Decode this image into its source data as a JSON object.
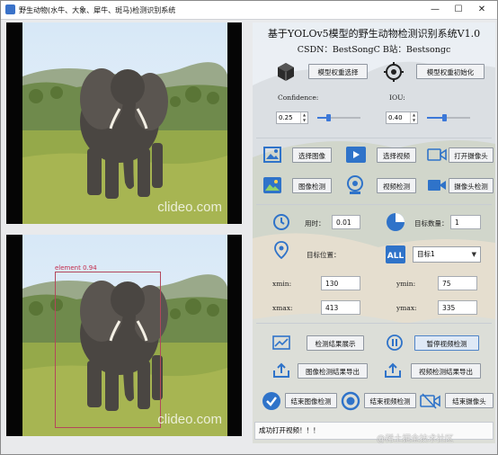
{
  "window": {
    "title": "野生动物(水牛、大象、犀牛、斑马)检测识别系统",
    "minimize_glyph": "—",
    "maximize_glyph": "☐",
    "close_glyph": "✕"
  },
  "header": {
    "title": "基于YOLOv5模型的野生动物检测识别系统V1.0",
    "info": "CSDN：BestSongC   B站：Bestsongc"
  },
  "model": {
    "select_label": "模型权重选择",
    "init_label": "模型权重初始化",
    "select_icon": "cube-icon",
    "init_icon": "target-settings-icon"
  },
  "params": {
    "confidence_label": "Confidence:",
    "confidence_value": "0.25",
    "confidence_level": 0.25,
    "iou_label": "IOU:",
    "iou_value": "0.40",
    "iou_level": 0.4
  },
  "inputs": {
    "select_image": "选择图像",
    "select_video": "选择视频",
    "open_camera": "打开摄像头",
    "image_detect": "图像检测",
    "video_detect": "视频检测",
    "camera_detect": "摄像头检测"
  },
  "results": {
    "time_label": "用时：",
    "time_value": "0.01",
    "count_label": "目标数量：",
    "count_value": "1",
    "position_label": "目标位置：",
    "target_select": "目标1",
    "xmin_label": "xmin:",
    "xmin_value": "130",
    "ymin_label": "ymin:",
    "ymin_value": "75",
    "xmax_label": "xmax:",
    "xmax_value": "413",
    "ymax_label": "ymax:",
    "ymax_value": "335"
  },
  "actions": {
    "show_results": "检测结果展示",
    "pause_video": "暂停视频检测",
    "export_image": "图像检测结果导出",
    "export_video": "视频检测结果导出",
    "end_image": "结束图像检测",
    "end_video": "结束视频检测",
    "end_camera": "结束摄像头"
  },
  "status": {
    "message": "成功打开视频！！！"
  },
  "detection": {
    "label": "element 0.94"
  },
  "watermarks": {
    "photo": "clideo.com",
    "brand": "@稀土掘金技术社区"
  },
  "colors": {
    "accent": "#3c78d8",
    "box": "#b3475b"
  }
}
